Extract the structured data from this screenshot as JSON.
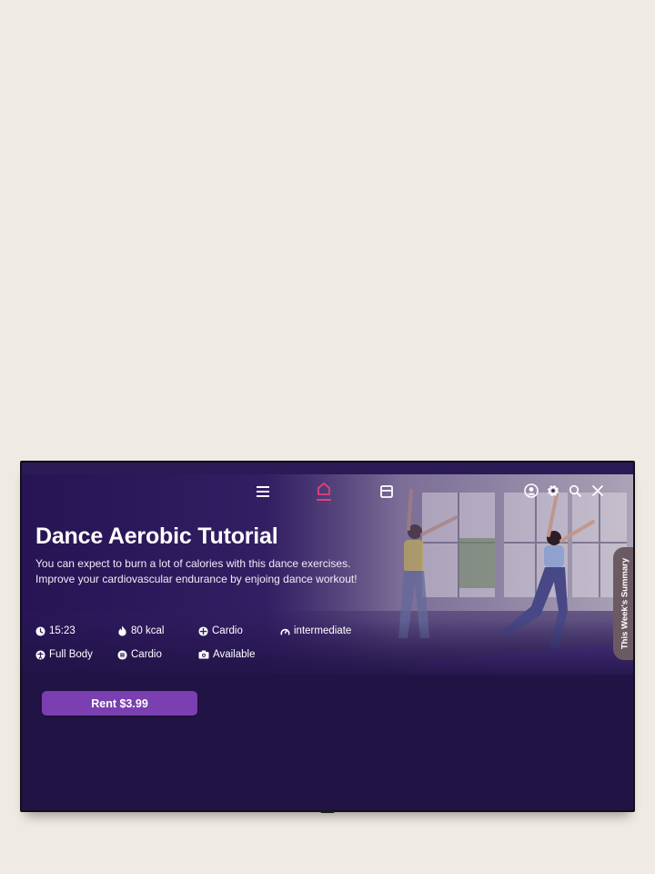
{
  "nav": {
    "menu_icon": "hamburger-icon",
    "home_icon": "home-icon",
    "library_icon": "library-icon",
    "profile_icon": "profile-icon",
    "settings_icon": "gear-icon",
    "search_icon": "search-icon",
    "close_icon": "close-icon",
    "active_tab": "home"
  },
  "hero": {
    "title": "Dance Aerobic Tutorial",
    "description_line1": "You can expect to burn a lot of calories with this dance exercises.",
    "description_line2": "Improve your cardiovascular endurance by enjoing dance workout!"
  },
  "meta": {
    "duration": "15:23",
    "calories": "80 kcal",
    "category": "Cardio",
    "level": "intermediate",
    "body_part": "Full Body",
    "type": "Cardio",
    "camera": "Available"
  },
  "summary_tab": {
    "label": "This Week's Summary"
  },
  "actions": {
    "rent_label": "Rent $3.99"
  },
  "colors": {
    "background": "#efebe4",
    "screen": "#211445",
    "accent_pink": "#e0407a",
    "button": "#7a3fb0"
  }
}
